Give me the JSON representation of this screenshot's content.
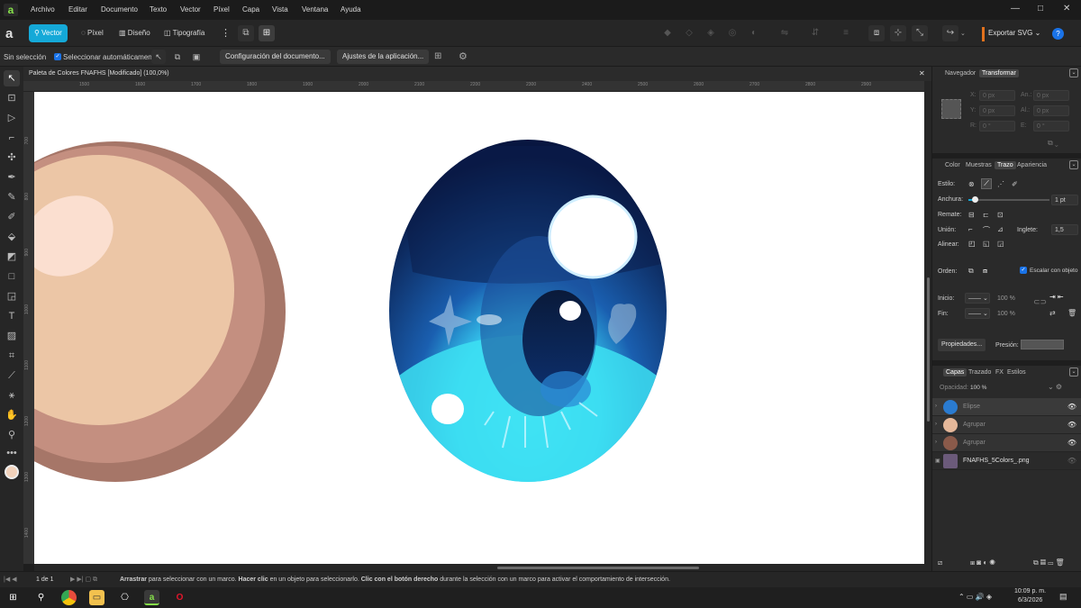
{
  "app": {
    "logo": "a"
  },
  "menu": [
    "Archivo",
    "Editar",
    "Documento",
    "Texto",
    "Vector",
    "Píxel",
    "Capa",
    "Vista",
    "Ventana",
    "Ayuda"
  ],
  "window_controls": {
    "minimize": "—",
    "maximize": "□",
    "close": "✕"
  },
  "personas": {
    "vector": "Vector",
    "pixel": "Píxel",
    "layout": "Diseño",
    "typography": "Tipografía"
  },
  "export_label": "Exportar SVG",
  "context": {
    "no_selection": "Sin selección",
    "auto_select": "Seleccionar automáticamente:",
    "doc_setup": "Configuración del documento...",
    "app_settings": "Ajustes de la aplicación..."
  },
  "document_tab": "Paleta de Colores FNAFHS [Modificado] (100,0%)",
  "ruler_top": [
    "1500",
    "1600",
    "1700",
    "1800",
    "1900",
    "2000",
    "2100",
    "2200",
    "2300",
    "2400",
    "2500",
    "2600",
    "2700",
    "2800",
    "2900"
  ],
  "ruler_left": [
    "700",
    "800",
    "900",
    "1000",
    "1100",
    "1200",
    "1300",
    "1400"
  ],
  "panels": {
    "nav_tabs": {
      "navigator": "Navegador",
      "transform": "Transformar"
    },
    "transform": {
      "x_label": "X:",
      "x": "0 px",
      "y_label": "Y:",
      "y": "0 px",
      "w_label": "An.:",
      "w": "0 px",
      "h_label": "Al.:",
      "h": "0 px",
      "r_label": "R:",
      "r": "0 °",
      "s_label": "E:",
      "s": "0 °"
    },
    "stroke_tabs": {
      "color": "Color",
      "swatches": "Muestras",
      "stroke": "Trazo",
      "appearance": "Apariencia"
    },
    "stroke": {
      "style": "Estilo:",
      "width": "Anchura:",
      "width_value": "1 pt",
      "width_fraction": 0.08,
      "cap": "Remate:",
      "join": "Unión:",
      "miter": "Inglete:",
      "miter_value": "1,5",
      "align": "Alinear:",
      "order": "Orden:",
      "scale": "Escalar con objeto",
      "start": "Inicio:",
      "end": "Fin:",
      "start_pct": "100 %",
      "end_pct": "100 %",
      "properties": "Propiedades...",
      "pressure": "Presión:"
    },
    "layer_tabs": {
      "layers": "Capas",
      "path": "Trazado",
      "fx": "FX",
      "styles": "Estilos"
    },
    "opacity_label": "Opacidad:",
    "opacity": "100 %",
    "layers": [
      {
        "name": "Elipse",
        "color": "#2a7bd0"
      },
      {
        "name": "Agrupar",
        "color": "#e5b89a"
      },
      {
        "name": "Agrupar",
        "color": "#8a5a4a"
      },
      {
        "name": "FNAFHS_5Colors_.png",
        "color": "#6b5a7a"
      }
    ]
  },
  "status": {
    "page": "1 de 1",
    "hint_b1": "Arrastrar",
    "hint_t1": " para seleccionar con un marco. ",
    "hint_b2": "Hacer clic",
    "hint_t2": " en un objeto para seleccionarlo. ",
    "hint_b3": "Clic con el botón derecho",
    "hint_t3": " durante la selección con un marco para activar el comportamiento de intersección."
  },
  "taskbar": {
    "time": "10:09 p. m.",
    "date": "6/3/2026"
  },
  "colors": {
    "accent": "#15a9d8",
    "skin_light": "#ecc6a6",
    "skin_mid": "#c48f80",
    "skin_dark": "#a67668",
    "eye_dark": "#0b1e4a",
    "eye_light": "#3fe6f5"
  }
}
